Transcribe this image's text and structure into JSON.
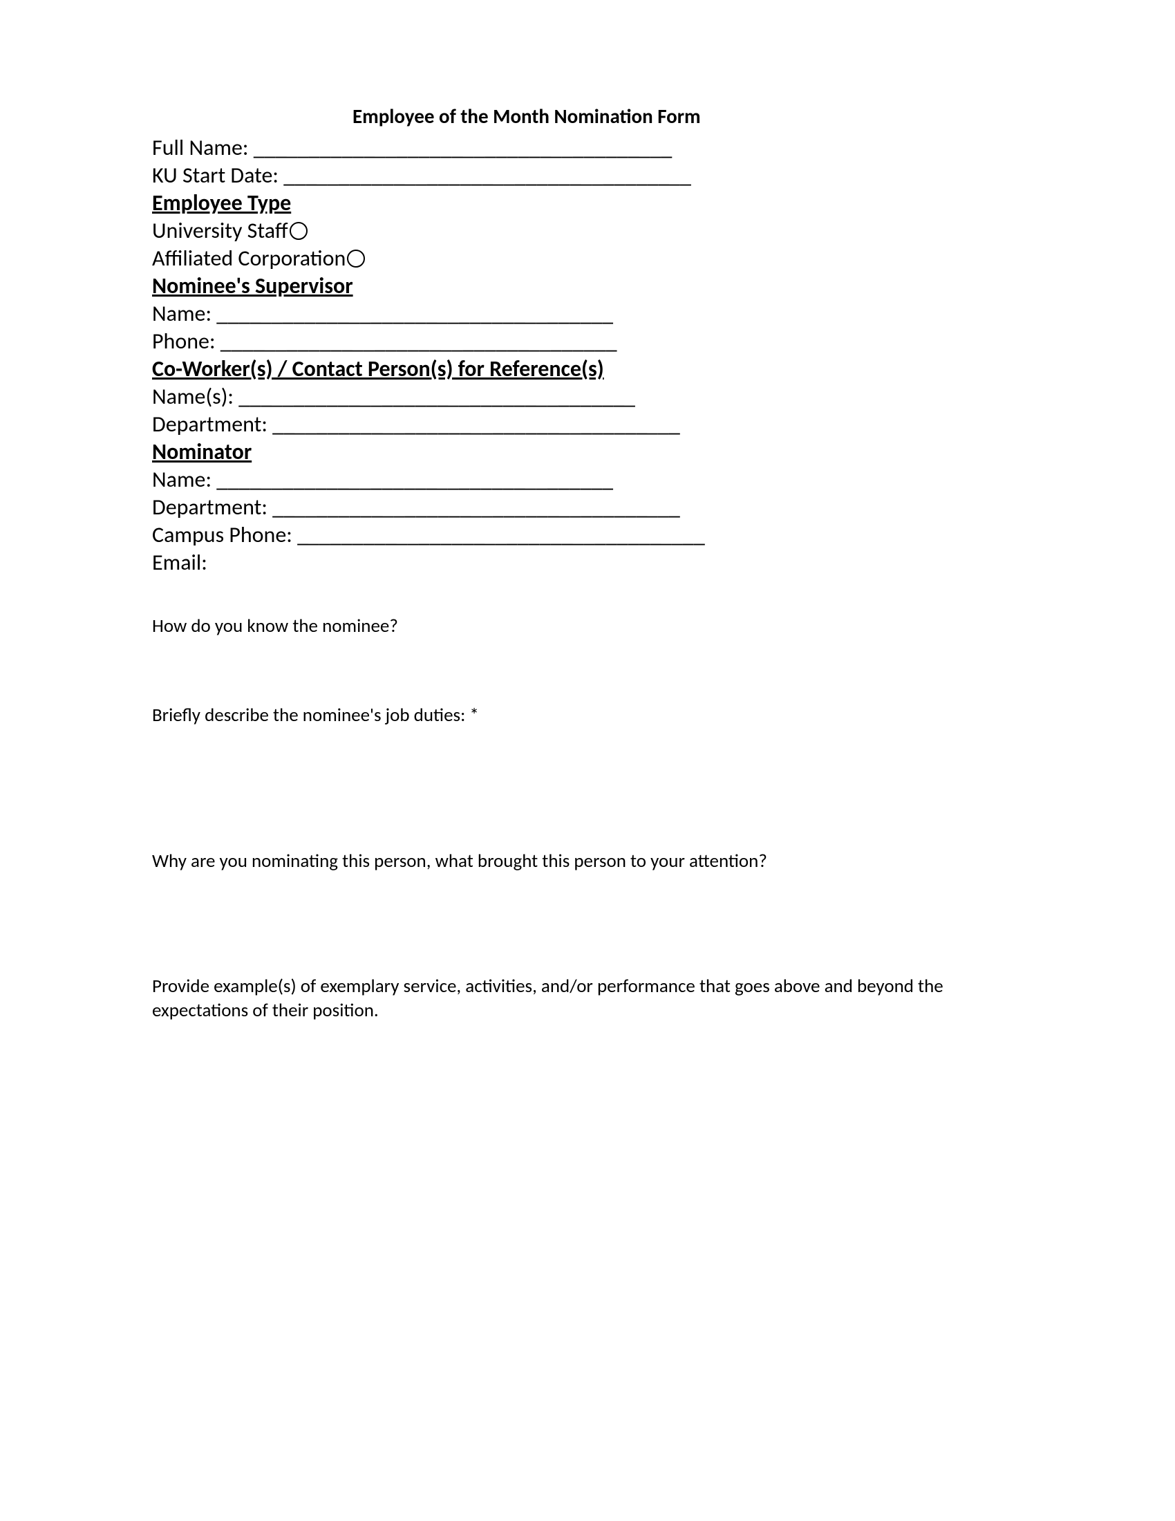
{
  "title": "Employee of the Month Nomination Form",
  "fields": {
    "full_name_label": "Full Name: ______________________________________",
    "ku_start_date_label": "KU Start Date: _____________________________________"
  },
  "employee_type": {
    "header": "Employee Type",
    "option1": "University Staff",
    "option2": "Affiliated Corporation"
  },
  "supervisor": {
    "header": "Nominee's Supervisor",
    "name_label": "Name: ____________________________________",
    "phone_label": "Phone: ____________________________________"
  },
  "coworker": {
    "header": "Co-Worker(s) / Contact Person(s) for Reference(s)",
    "names_label": "Name(s): ____________________________________",
    "department_label": "Department: _____________________________________"
  },
  "nominator": {
    "header": "Nominator",
    "name_label": "Name: ____________________________________",
    "department_label": "Department: _____________________________________",
    "campus_phone_label": "Campus Phone: _____________________________________",
    "email_label": "Email:"
  },
  "questions": {
    "q1": "How do you know the nominee?",
    "q2": "Briefly describe the nominee's job duties: *",
    "q3": "Why are you nominating this person, what brought this person to your attention?",
    "q4": "Provide example(s) of exemplary service, activities, and/or performance that goes above and beyond the expectations of their position."
  }
}
